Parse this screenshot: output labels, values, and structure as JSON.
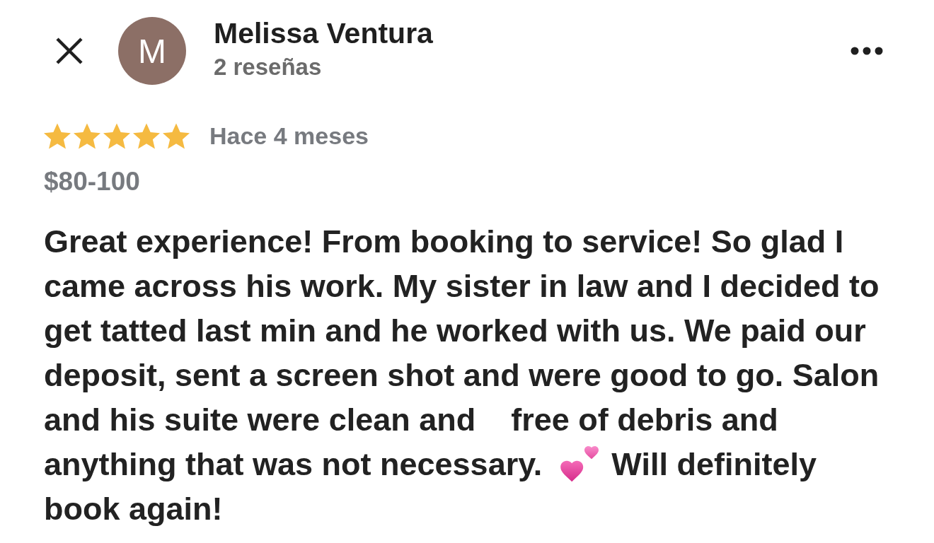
{
  "header": {
    "avatar_initial": "M",
    "name": "Melissa Ventura",
    "review_count": "2 reseñas"
  },
  "review": {
    "stars": 5,
    "time": "Hace 4 meses",
    "price": "$80-100",
    "body": [
      {
        "kind": "text",
        "text": "Great experience! From booking to service! So glad I came across his work. My sister in law and I decided to get tatted last min and he worked with us. We paid our deposit, sent a screen shot and were good to go. Salon and his suite were clean and    free of debris and anything that was not necessary."
      },
      {
        "kind": "hearts"
      },
      {
        "kind": "text",
        "text": "Will definitely book again!"
      }
    ]
  }
}
